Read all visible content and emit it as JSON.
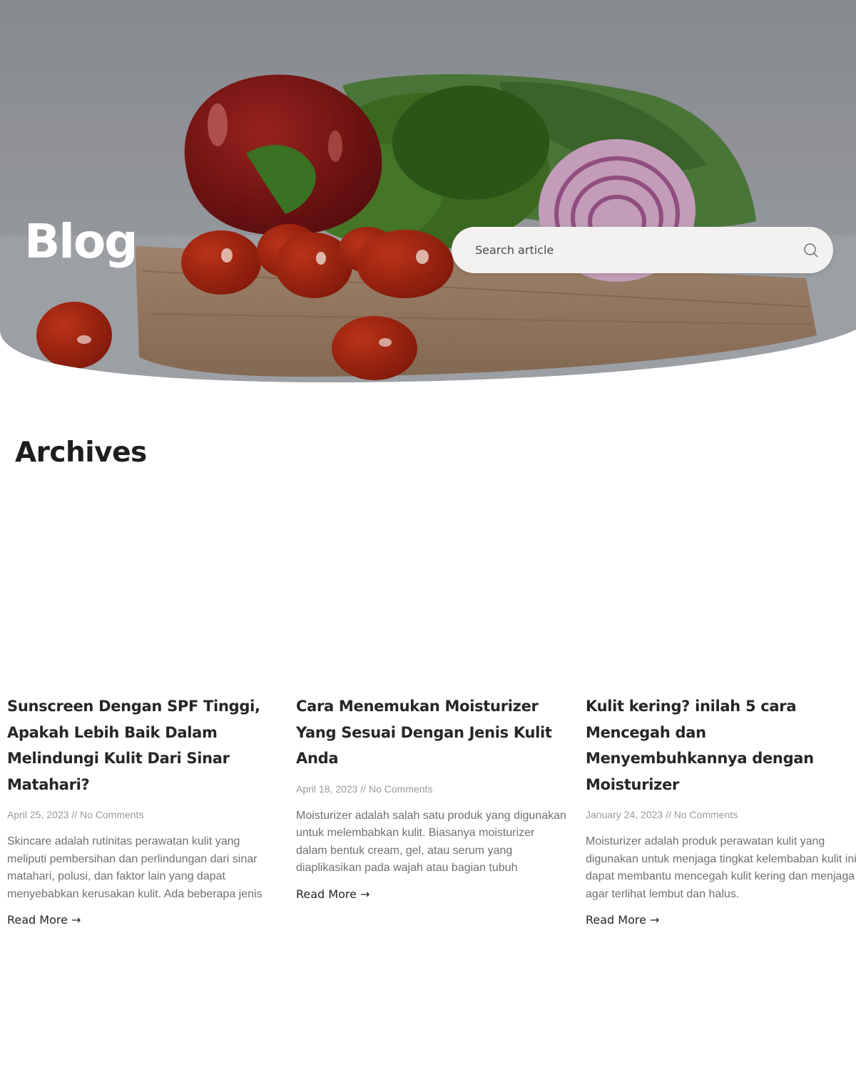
{
  "hero": {
    "title": "Blog",
    "search": {
      "placeholder": "Search article"
    }
  },
  "archives": {
    "title": "Archives",
    "posts": [
      {
        "title": "Sunscreen Dengan SPF Tinggi, Apakah Lebih Baik Dalam Melindungi Kulit Dari Sinar Matahari?",
        "date": "April 25, 2023",
        "separator": " // ",
        "comments": "No Comments",
        "excerpt": "Skincare adalah rutinitas perawatan kulit yang meliputi pembersihan dan perlindungan dari sinar matahari, polusi, dan faktor lain yang dapat menyebabkan kerusakan kulit. Ada beberapa jenis",
        "read_more": "Read More →"
      },
      {
        "title": "Cara Menemukan Moisturizer Yang Sesuai Dengan Jenis Kulit Anda",
        "date": "April 18, 2023",
        "separator": " // ",
        "comments": "No Comments",
        "excerpt": "Moisturizer adalah salah satu produk yang digunakan untuk melembabkan kulit. Biasanya moisturizer dalam bentuk cream, gel, atau serum yang diaplikasikan pada wajah atau bagian tubuh",
        "read_more": "Read More →"
      },
      {
        "title": "Kulit kering? inilah 5 cara Mencegah dan Menyembuhkannya dengan Moisturizer",
        "date": "January 24, 2023",
        "separator": " // ",
        "comments": "No Comments",
        "excerpt": "Moisturizer adalah produk perawatan kulit yang digunakan untuk menjaga tingkat kelembaban kulit ini dapat membantu mencegah kulit kering dan menjaga agar terlihat lembut dan halus.",
        "read_more": "Read More →"
      }
    ]
  }
}
